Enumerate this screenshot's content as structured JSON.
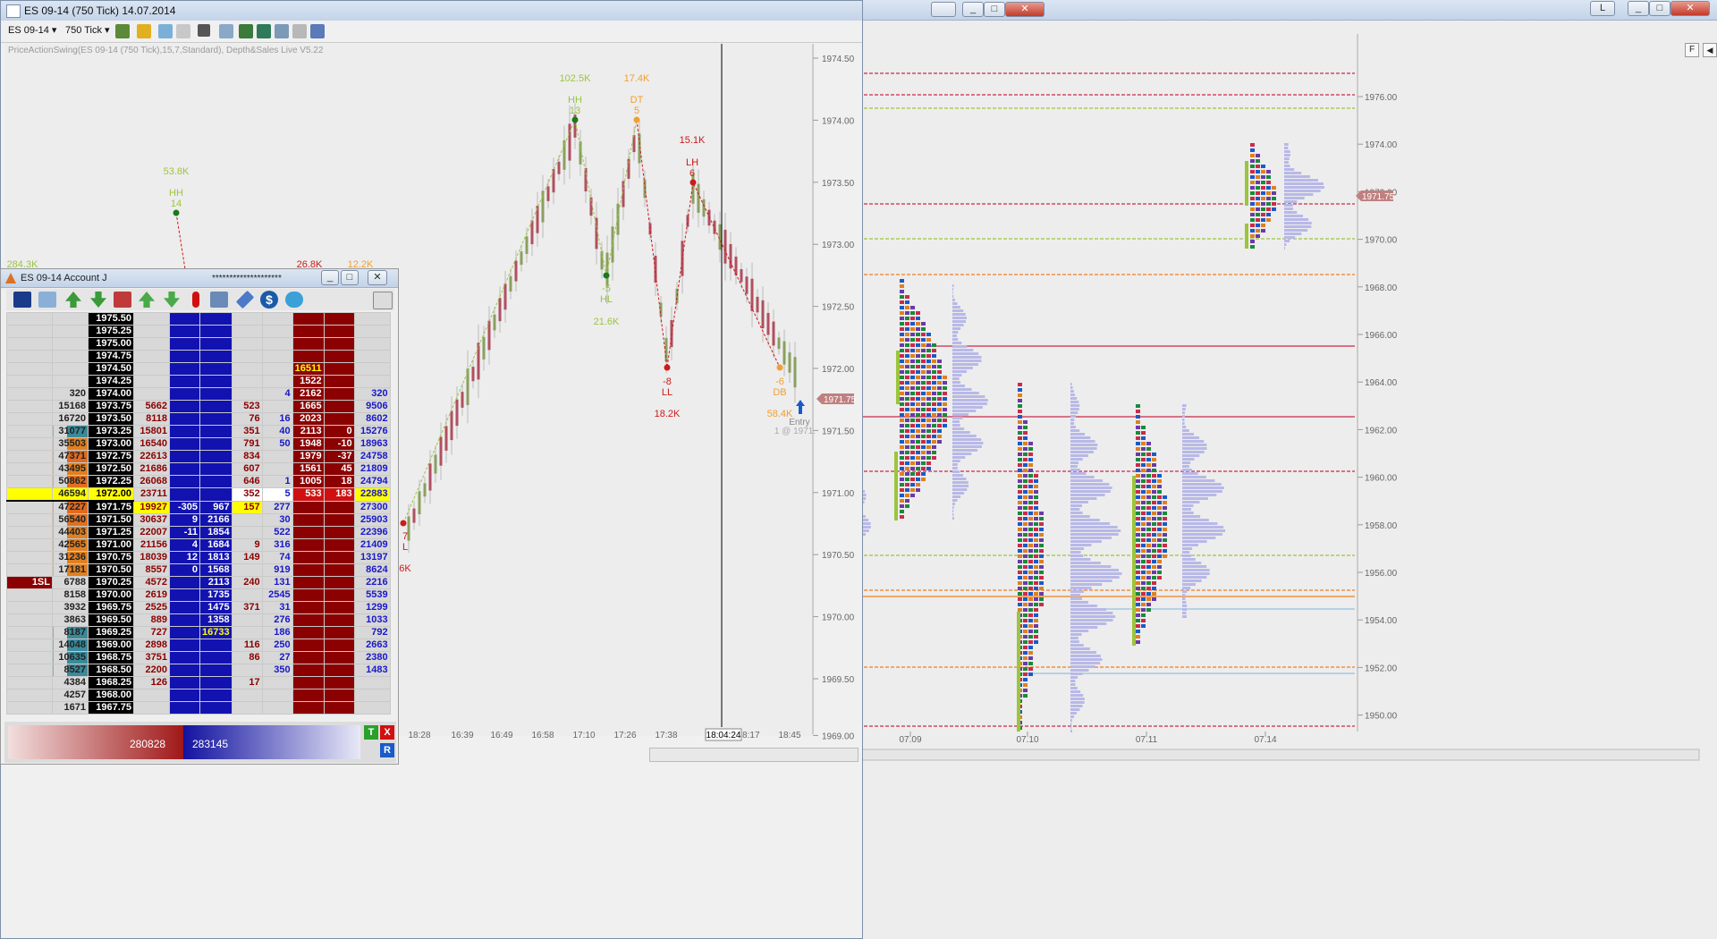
{
  "chart_window": {
    "title": "ES 09-14 (750 Tick)  14.07.2014",
    "instrument": "ES 09-14",
    "interval": "750 Tick",
    "indicator_label": "PriceActionSwing(ES 09-14 (750 Tick),15,7,Standard), Depth&Sales Live V5.22",
    "price_axis": [
      "1974.50",
      "1974.00",
      "1973.50",
      "1973.00",
      "1972.50",
      "1972.00",
      "1971.50",
      "1971.00",
      "1970.50",
      "1970.00",
      "1969.50",
      "1969.00"
    ],
    "time_axis": [
      "18:28",
      "16:39",
      "16:49",
      "16:58",
      "17:10",
      "17:26",
      "17:38",
      "18:04:24",
      "18:17",
      "18:45"
    ],
    "last_price": "1971.75",
    "cursor_time": "18:04:24",
    "entry_label": "Entry",
    "entry_detail": "1 @ 1971.",
    "swings": [
      {
        "vol": "102.5K",
        "type": "HH",
        "count": "13",
        "color": "#9bc53d"
      },
      {
        "vol": "17.4K",
        "type": "DT",
        "count": "5",
        "color": "#f0a030"
      },
      {
        "vol": "15.1K",
        "type": "LH",
        "count": "6",
        "color": "#cc1b1b"
      },
      {
        "vol": "53.8K",
        "type": "HH",
        "count": "14",
        "color": "#9bc53d"
      },
      {
        "vol": "21.6K",
        "type": "HL",
        "count": "-5",
        "color": "#9bc53d"
      },
      {
        "vol": "18.2K",
        "type": "LL",
        "count": "-8",
        "color": "#cc1b1b"
      },
      {
        "vol": "58.4K",
        "type": "DB",
        "count": "-6",
        "color": "#f0a030"
      },
      {
        "vol": "284.3K",
        "type": "",
        "count": "",
        "color": "#9bc53d"
      },
      {
        "vol": "26.8K",
        "type": "",
        "count": "",
        "color": "#cc1b1b"
      },
      {
        "vol": "12.2K",
        "type": "",
        "count": "",
        "color": "#f0a030"
      },
      {
        "vol": "6K",
        "type": "L",
        "count": "7",
        "color": "#cc1b1b"
      }
    ],
    "buttons": {
      "min": "_",
      "max": "□",
      "close": "✕"
    }
  },
  "profile_window": {
    "price_axis": [
      "1976.00",
      "1974.00",
      "1972.00",
      "1970.00",
      "1968.00",
      "1966.00",
      "1964.00",
      "1962.00",
      "1960.00",
      "1958.00",
      "1956.00",
      "1954.00",
      "1952.00",
      "1950.00"
    ],
    "date_axis": [
      "07.09",
      "07.10",
      "07.11",
      "07.14"
    ],
    "last_price": "1971.75",
    "side_button": "F"
  },
  "dom_window": {
    "title": "ES 09-14  Account J",
    "account_mask": "********************",
    "sl_label": "1SL",
    "buy_total": "280828",
    "sell_total": "283145",
    "btn_t": "T",
    "btn_x": "X",
    "btn_r": "R",
    "rows": [
      {
        "sl": "",
        "bvol": "",
        "price": "1975.50",
        "bsize": "",
        "bidd": "",
        "bid": "",
        "sells": "",
        "buys": "",
        "ask": "",
        "askd": "",
        "tot": ""
      },
      {
        "sl": "",
        "bvol": "",
        "price": "1975.25",
        "bsize": "",
        "bidd": "",
        "bid": "",
        "sells": "",
        "buys": "",
        "ask": "",
        "askd": "",
        "tot": ""
      },
      {
        "sl": "",
        "bvol": "",
        "price": "1975.00",
        "bsize": "",
        "bidd": "",
        "bid": "",
        "sells": "",
        "buys": "",
        "ask": "",
        "askd": "",
        "tot": ""
      },
      {
        "sl": "",
        "bvol": "",
        "price": "1974.75",
        "bsize": "",
        "bidd": "",
        "bid": "",
        "sells": "",
        "buys": "",
        "ask": "",
        "askd": "",
        "tot": ""
      },
      {
        "sl": "",
        "bvol": "",
        "price": "1974.50",
        "bsize": "",
        "bidd": "",
        "bid": "",
        "sells": "",
        "buys": "",
        "ask": "16511",
        "askd": "",
        "tot": ""
      },
      {
        "sl": "",
        "bvol": "",
        "price": "1974.25",
        "bsize": "",
        "bidd": "",
        "bid": "",
        "sells": "",
        "buys": "",
        "ask": "1522",
        "askd": "",
        "tot": ""
      },
      {
        "sl": "",
        "bvol": "320",
        "price": "1974.00",
        "bsize": "",
        "bidd": "",
        "bid": "",
        "sells": "",
        "buys": "4",
        "ask": "2162",
        "askd": "",
        "tot": "320"
      },
      {
        "sl": "",
        "bvol": "15168",
        "price": "1973.75",
        "bsize": "5662",
        "bidd": "",
        "bid": "",
        "sells": "523",
        "buys": "",
        "ask": "1665",
        "askd": "",
        "tot": "9506"
      },
      {
        "sl": "",
        "bvol": "16720",
        "price": "1973.50",
        "bsize": "8118",
        "bidd": "",
        "bid": "",
        "sells": "76",
        "buys": "16",
        "ask": "2023",
        "askd": "",
        "tot": "8602"
      },
      {
        "sl": "",
        "bvol": "31077",
        "price": "1973.25",
        "bsize": "15801",
        "bidd": "",
        "bid": "",
        "sells": "351",
        "buys": "40",
        "ask": "2113",
        "askd": "0",
        "tot": "15276"
      },
      {
        "sl": "",
        "bvol": "35503",
        "price": "1973.00",
        "bsize": "16540",
        "bidd": "",
        "bid": "",
        "sells": "791",
        "buys": "50",
        "ask": "1948",
        "askd": "-10",
        "tot": "18963"
      },
      {
        "sl": "",
        "bvol": "47371",
        "price": "1972.75",
        "bsize": "22613",
        "bidd": "",
        "bid": "",
        "sells": "834",
        "buys": "",
        "ask": "1979",
        "askd": "-37",
        "tot": "24758"
      },
      {
        "sl": "",
        "bvol": "43495",
        "price": "1972.50",
        "bsize": "21686",
        "bidd": "",
        "bid": "",
        "sells": "607",
        "buys": "",
        "ask": "1561",
        "askd": "45",
        "tot": "21809"
      },
      {
        "sl": "",
        "bvol": "50862",
        "price": "1972.25",
        "bsize": "26068",
        "bidd": "",
        "bid": "",
        "sells": "646",
        "buys": "1",
        "ask": "1005",
        "askd": "18",
        "tot": "24794"
      },
      {
        "sl": "",
        "bvol": "46594",
        "price": "1972.00",
        "bsize": "23711",
        "bidd": "",
        "bid": "",
        "sells": "352",
        "buys": "5",
        "ask": "533",
        "askd": "183",
        "tot": "22883"
      },
      {
        "sl": "",
        "bvol": "47227",
        "price": "1971.75",
        "bsize": "19927",
        "bidd": "-305",
        "bid": "967",
        "sells": "157",
        "buys": "277",
        "ask": "",
        "askd": "",
        "tot": "27300"
      },
      {
        "sl": "",
        "bvol": "56540",
        "price": "1971.50",
        "bsize": "30637",
        "bidd": "9",
        "bid": "2166",
        "sells": "",
        "buys": "30",
        "ask": "",
        "askd": "",
        "tot": "25903"
      },
      {
        "sl": "",
        "bvol": "44403",
        "price": "1971.25",
        "bsize": "22007",
        "bidd": "-11",
        "bid": "1854",
        "sells": "",
        "buys": "522",
        "ask": "",
        "askd": "",
        "tot": "22396"
      },
      {
        "sl": "",
        "bvol": "42565",
        "price": "1971.00",
        "bsize": "21156",
        "bidd": "4",
        "bid": "1684",
        "sells": "9",
        "buys": "316",
        "ask": "",
        "askd": "",
        "tot": "21409"
      },
      {
        "sl": "",
        "bvol": "31236",
        "price": "1970.75",
        "bsize": "18039",
        "bidd": "12",
        "bid": "1813",
        "sells": "149",
        "buys": "74",
        "ask": "",
        "askd": "",
        "tot": "13197"
      },
      {
        "sl": "",
        "bvol": "17181",
        "price": "1970.50",
        "bsize": "8557",
        "bidd": "0",
        "bid": "1568",
        "sells": "",
        "buys": "919",
        "ask": "",
        "askd": "",
        "tot": "8624"
      },
      {
        "sl": "1SL",
        "bvol": "6788",
        "price": "1970.25",
        "bsize": "4572",
        "bidd": "",
        "bid": "2113",
        "sells": "240",
        "buys": "131",
        "ask": "",
        "askd": "",
        "tot": "2216"
      },
      {
        "sl": "",
        "bvol": "8158",
        "price": "1970.00",
        "bsize": "2619",
        "bidd": "",
        "bid": "1735",
        "sells": "",
        "buys": "2545",
        "ask": "",
        "askd": "",
        "tot": "5539"
      },
      {
        "sl": "",
        "bvol": "3932",
        "price": "1969.75",
        "bsize": "2525",
        "bidd": "",
        "bid": "1475",
        "sells": "371",
        "buys": "31",
        "ask": "",
        "askd": "",
        "tot": "1299"
      },
      {
        "sl": "",
        "bvol": "3863",
        "price": "1969.50",
        "bsize": "889",
        "bidd": "",
        "bid": "1358",
        "sells": "",
        "buys": "276",
        "ask": "",
        "askd": "",
        "tot": "1033"
      },
      {
        "sl": "",
        "bvol": "8187",
        "price": "1969.25",
        "bsize": "727",
        "bidd": "",
        "bid": "16733",
        "sells": "",
        "buys": "186",
        "ask": "",
        "askd": "",
        "tot": "792"
      },
      {
        "sl": "",
        "bvol": "14048",
        "price": "1969.00",
        "bsize": "2898",
        "bidd": "",
        "bid": "",
        "sells": "116",
        "buys": "250",
        "ask": "",
        "askd": "",
        "tot": "2663"
      },
      {
        "sl": "",
        "bvol": "10635",
        "price": "1968.75",
        "bsize": "3751",
        "bidd": "",
        "bid": "",
        "sells": "86",
        "buys": "27",
        "ask": "",
        "askd": "",
        "tot": "2380"
      },
      {
        "sl": "",
        "bvol": "8527",
        "price": "1968.50",
        "bsize": "2200",
        "bidd": "",
        "bid": "",
        "sells": "",
        "buys": "350",
        "ask": "",
        "askd": "",
        "tot": "1483"
      },
      {
        "sl": "",
        "bvol": "4384",
        "price": "1968.25",
        "bsize": "126",
        "bidd": "",
        "bid": "",
        "sells": "17",
        "buys": "",
        "ask": "",
        "askd": "",
        "tot": ""
      },
      {
        "sl": "",
        "bvol": "4257",
        "price": "1968.00",
        "bsize": "",
        "bidd": "",
        "bid": "",
        "sells": "",
        "buys": "",
        "ask": "",
        "askd": "",
        "tot": ""
      },
      {
        "sl": "",
        "bvol": "1671",
        "price": "1967.75",
        "bsize": "",
        "bidd": "",
        "bid": "",
        "sells": "",
        "buys": "",
        "ask": "",
        "askd": "",
        "tot": ""
      }
    ]
  },
  "colors": {
    "bid_blue": "#1212b0",
    "ask_red": "#8b0000",
    "inside_yellow": "#ffff00",
    "swing_green": "#9bc53d",
    "swing_orange": "#f0a030",
    "swing_red": "#cc1b1b"
  }
}
